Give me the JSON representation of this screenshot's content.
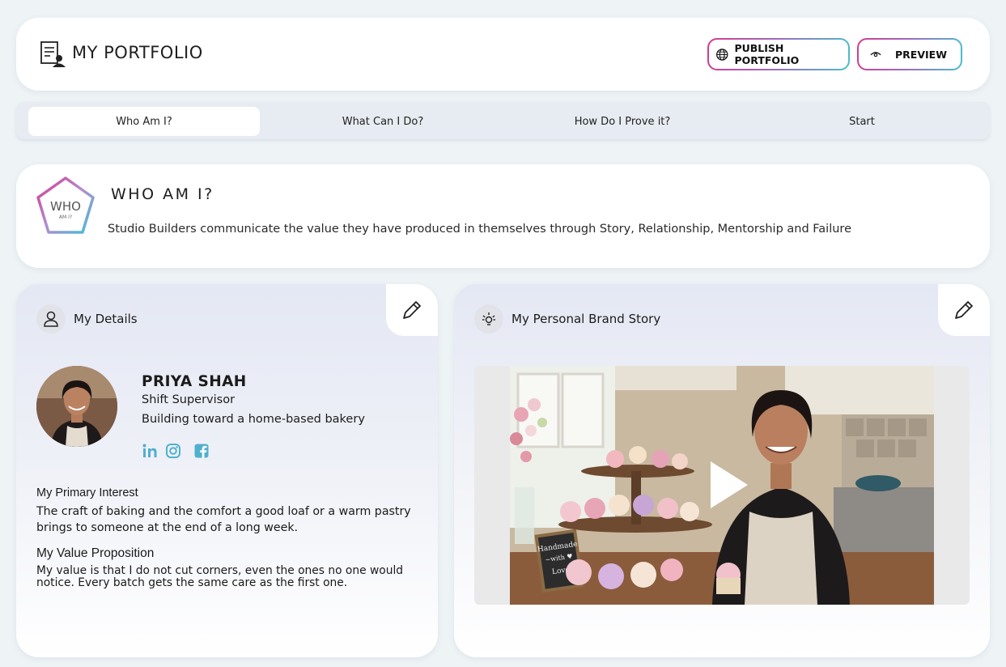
{
  "header": {
    "title": "MY PORTFOLIO",
    "publish_label": "PUBLISH PORTFOLIO",
    "preview_label": "PREVIEW"
  },
  "tabs": [
    {
      "label": "Who Am I?",
      "active": true
    },
    {
      "label": "What Can I Do?",
      "active": false
    },
    {
      "label": "How Do I Prove it?",
      "active": false
    },
    {
      "label": "Start",
      "active": false
    }
  ],
  "who": {
    "badge_text": "WHO",
    "badge_subtext": "AM I?",
    "heading": "WHO AM I?",
    "description": "Studio Builders communicate the value they have produced in themselves through Story, Relationship, Mentorship and Failure"
  },
  "details": {
    "section_title": "My Details",
    "name": "PRIYA SHAH",
    "role": "Shift Supervisor",
    "goal": "Building toward a home-based bakery",
    "socials": [
      "linkedin-icon",
      "instagram-icon",
      "facebook-icon"
    ],
    "primary_interest_label": "My Primary Interest",
    "primary_interest": "The craft of baking and the comfort a good loaf or a warm pastry brings to someone at the end of a long week.",
    "value_prop_label": "My Value Proposition",
    "value_prop": "My value is that I do not cut corners, even the ones no one would notice. Every batch gets the same care as the first one."
  },
  "brand_story": {
    "section_title": "My Personal Brand Story",
    "sign_text": "Handmade with Love"
  },
  "colors": {
    "accent_pink": "#d23b8f",
    "accent_teal": "#48bfcc",
    "social_blue": "#4fb0cf",
    "background": "#eef3f6"
  }
}
